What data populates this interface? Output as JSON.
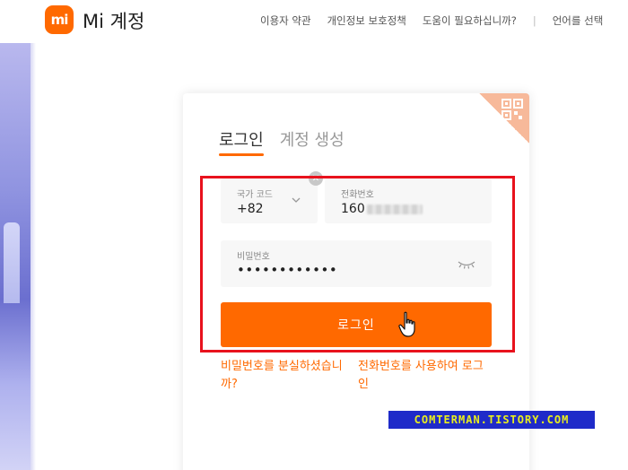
{
  "header": {
    "logo_text": "mi",
    "brand": "Mi 계정",
    "nav": [
      "이용자 약관",
      "개인정보 보호정책",
      "도움이 필요하십니까?",
      "언어를 선택"
    ]
  },
  "login": {
    "tabs": [
      "로그인",
      "계정 생성"
    ],
    "country": {
      "label": "국가 코드",
      "value": "+82"
    },
    "phone": {
      "label": "전화번호",
      "value_visible": "160"
    },
    "password": {
      "label": "비밀번호",
      "value": "••••••••••••"
    },
    "submit_label": "로그인",
    "forgot_link": "비밀번호를 분실하셨습니까?",
    "sms_link": "전화번호를 사용하여 로그인"
  },
  "watermark": "COMTERMAN.TISTORY.COM",
  "colors": {
    "accent": "#ff6900",
    "highlight": "#e8121d",
    "watermark_bg": "#1f2bc9",
    "watermark_text": "#e9ef1c"
  }
}
